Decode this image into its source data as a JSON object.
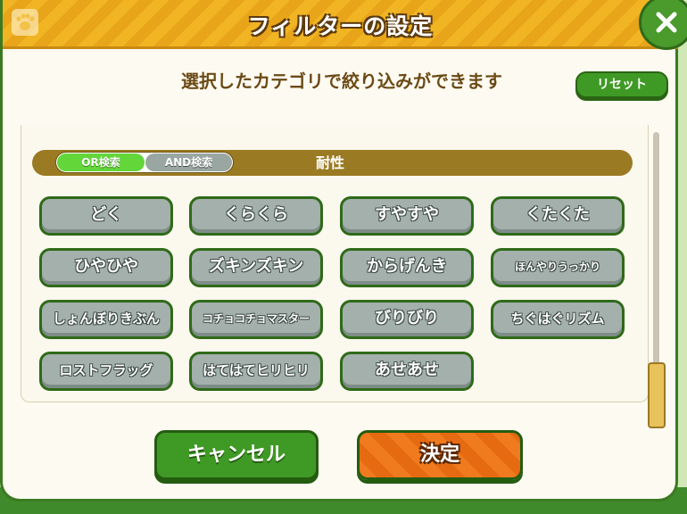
{
  "header": {
    "title": "フィルターの設定",
    "icon": "paw-icon",
    "close_icon": "close-icon"
  },
  "subtitle": "選択したカテゴリで絞り込みができます",
  "reset_label": "リセット",
  "filter": {
    "or_label": "OR検索",
    "and_label": "AND検索",
    "selected_mode": "OR検索",
    "category": "耐性"
  },
  "tags": [
    "どく",
    "くらくら",
    "すやすや",
    "くたくた",
    "ひやひや",
    "ズキンズキン",
    "からげんき",
    "ほんやりうっかり",
    "しょんぼりきぶん",
    "コチョコチョマスター",
    "びりびり",
    "ちぐはぐリズム",
    "ロストフラッグ",
    "はてはてヒリヒリ",
    "あせあせ"
  ],
  "scroll": {
    "position": 1.0
  },
  "buttons": {
    "cancel": "キャンセル",
    "ok": "決定"
  },
  "colors": {
    "header": "#f1b524",
    "primary_green": "#3f9a25",
    "tag_gray": "#a3b0ac",
    "ok_orange": "#f07a1e",
    "or_active": "#63d63a"
  }
}
